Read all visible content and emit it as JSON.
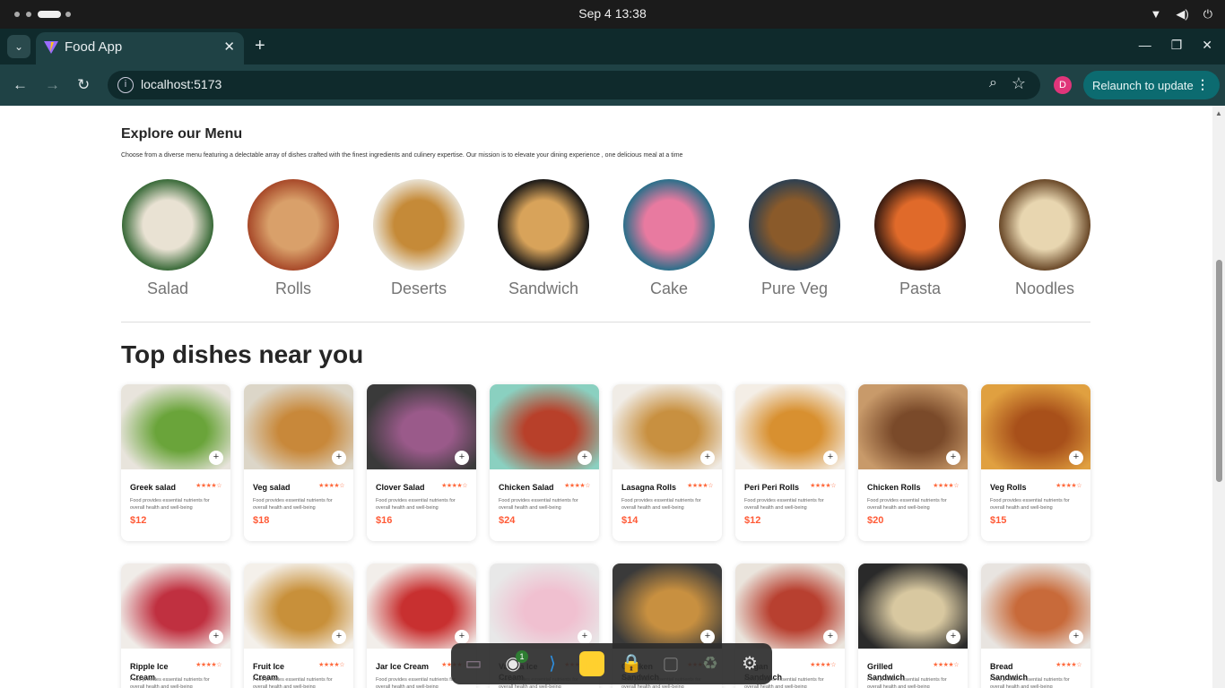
{
  "system": {
    "clock": "Sep 4  13:38"
  },
  "browser": {
    "tab_title": "Food App",
    "url": "localhost:5173",
    "profile_initial": "D",
    "relaunch_label": "Relaunch to update"
  },
  "menu": {
    "title": "Explore our Menu",
    "description": "Choose from a diverse menu featuring a delectable array of dishes crafted with the finest ingredients and culinery expertise. Our mission is to elevate your dining experience , one delicious meal at a time",
    "categories": [
      {
        "name": "Salad",
        "colors": [
          "#3b6b3a",
          "#e9e2d3"
        ]
      },
      {
        "name": "Rolls",
        "colors": [
          "#a84a2a",
          "#d9a06a"
        ]
      },
      {
        "name": "Deserts",
        "colors": [
          "#e8e0d0",
          "#c58a38"
        ]
      },
      {
        "name": "Sandwich",
        "colors": [
          "#1c1a18",
          "#d8a35a"
        ]
      },
      {
        "name": "Cake",
        "colors": [
          "#2d6f8a",
          "#e87aa0"
        ]
      },
      {
        "name": "Pure Veg",
        "colors": [
          "#2f4050",
          "#8a5a2a"
        ]
      },
      {
        "name": "Pasta",
        "colors": [
          "#3b1d12",
          "#e06a2a"
        ]
      },
      {
        "name": "Noodles",
        "colors": [
          "#6b4a2a",
          "#e8d6b0"
        ]
      }
    ]
  },
  "top_dishes": {
    "title": "Top dishes near you",
    "rating": "★★★★☆",
    "description": "Food provides essential nutrients for overall health and well-being",
    "row1": [
      {
        "name": "Greek salad",
        "price": "$12",
        "colors": [
          "#e8e4dc",
          "#6aa43a"
        ]
      },
      {
        "name": "Veg salad",
        "price": "$18",
        "colors": [
          "#dcd6c8",
          "#c8883a"
        ]
      },
      {
        "name": "Clover Salad",
        "price": "$16",
        "colors": [
          "#3a3a3a",
          "#9a5a8a"
        ]
      },
      {
        "name": "Chicken Salad",
        "price": "$24",
        "colors": [
          "#8ad0c0",
          "#b8402a"
        ]
      },
      {
        "name": "Lasagna Rolls",
        "price": "$14",
        "colors": [
          "#f0ece6",
          "#c89040"
        ]
      },
      {
        "name": "Peri Peri Rolls",
        "price": "$12",
        "colors": [
          "#f4eee6",
          "#d89030"
        ]
      },
      {
        "name": "Chicken Rolls",
        "price": "$20",
        "colors": [
          "#c89a6a",
          "#7a4a2a"
        ]
      },
      {
        "name": "Veg Rolls",
        "price": "$15",
        "colors": [
          "#e0a040",
          "#a8501a"
        ]
      }
    ],
    "row2": [
      {
        "name": "Ripple Ice Cream",
        "colors": [
          "#f0ece8",
          "#c03040"
        ]
      },
      {
        "name": "Fruit Ice Cream",
        "colors": [
          "#f4f0ea",
          "#c8903a"
        ]
      },
      {
        "name": "Jar Ice Cream",
        "colors": [
          "#f2eeea",
          "#c83030"
        ]
      },
      {
        "name": "Vanilla Ice Cream",
        "colors": [
          "#e8e8e8",
          "#f0c0d0"
        ]
      },
      {
        "name": "Chicken Sandwich",
        "colors": [
          "#3a3a3a",
          "#c89040"
        ]
      },
      {
        "name": "Vegan Sandwich",
        "colors": [
          "#eae4dc",
          "#b84030"
        ]
      },
      {
        "name": "Grilled Sandwich",
        "colors": [
          "#2a2a2a",
          "#d8c8a0"
        ]
      },
      {
        "name": "Bread Sandwich",
        "colors": [
          "#e8e4e0",
          "#c86a3a"
        ]
      }
    ]
  },
  "dock": {
    "apps": [
      "files-icon",
      "chrome-icon",
      "vscode-icon",
      "miro-icon",
      "lock-icon",
      "ssd-icon",
      "trash-icon",
      "settings-icon"
    ],
    "chrome_badge": "1"
  }
}
